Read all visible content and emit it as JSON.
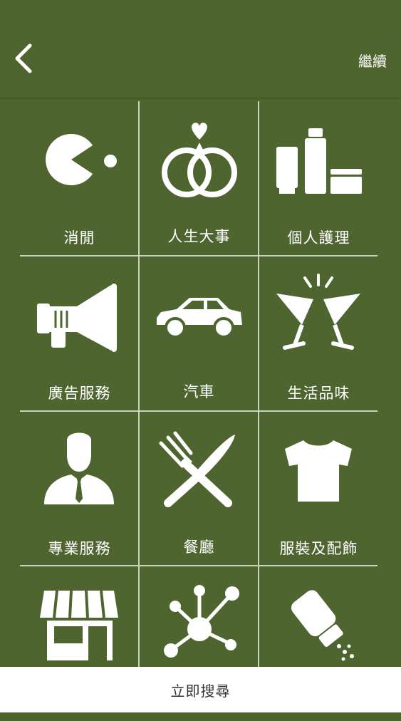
{
  "header": {
    "back_icon": "chevron-left-icon",
    "continue_label": "繼續"
  },
  "categories": [
    {
      "label": "消閒",
      "icon": "pacman-icon"
    },
    {
      "label": "人生大事",
      "icon": "wedding-rings-icon"
    },
    {
      "label": "個人護理",
      "icon": "cosmetics-icon"
    },
    {
      "label": "廣告服務",
      "icon": "megaphone-icon"
    },
    {
      "label": "汽車",
      "icon": "car-icon"
    },
    {
      "label": "生活品味",
      "icon": "cheers-glasses-icon"
    },
    {
      "label": "專業服務",
      "icon": "businessman-icon"
    },
    {
      "label": "餐廳",
      "icon": "fork-knife-icon"
    },
    {
      "label": "服裝及配飾",
      "icon": "tshirt-icon"
    },
    {
      "label": "",
      "icon": "storefront-icon"
    },
    {
      "label": "",
      "icon": "network-icon"
    },
    {
      "label": "",
      "icon": "salt-shaker-icon"
    }
  ],
  "footer": {
    "search_label": "立即搜尋"
  },
  "colors": {
    "background": "#4f6530",
    "grid_line": "#c8d3b8",
    "icon": "#ffffff",
    "footer_bg": "#ffffff",
    "footer_text": "#333333"
  }
}
